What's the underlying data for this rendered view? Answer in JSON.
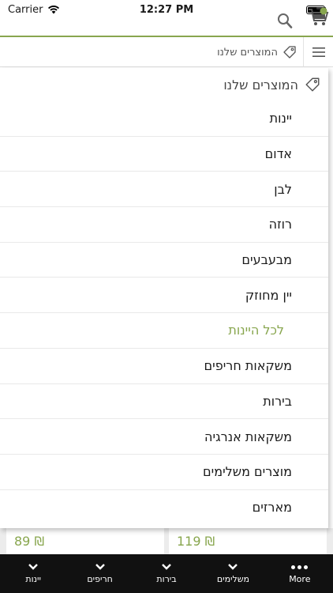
{
  "status_bar": {
    "carrier": "Carrier",
    "time": "12:27 PM"
  },
  "header": {
    "search_icon": "search-icon",
    "cart_icon": "cart-icon",
    "accent_color": "#88a64e"
  },
  "breadcrumb": {
    "label": "המוצרים שלנו"
  },
  "dropdown": {
    "title": "המוצרים שלנו",
    "items": [
      {
        "label": "יינות"
      },
      {
        "label": "אדום"
      },
      {
        "label": "לבן"
      },
      {
        "label": "רוזה"
      },
      {
        "label": "מבעבעים"
      },
      {
        "label": "יין מחוזק"
      },
      {
        "label": "לכל היינות"
      },
      {
        "label": "משקאות חריפים"
      },
      {
        "label": "בירות"
      },
      {
        "label": "משקאות אנרגיה"
      },
      {
        "label": "מוצרים משלימים"
      },
      {
        "label": "מארזים"
      }
    ]
  },
  "products": {
    "left_price": "89 ₪",
    "right_price": "119 ₪"
  },
  "bottom_nav": {
    "items": [
      {
        "label": "יינות"
      },
      {
        "label": "חריפים"
      },
      {
        "label": "בירות"
      },
      {
        "label": "משלימים"
      },
      {
        "label": "More"
      }
    ]
  }
}
